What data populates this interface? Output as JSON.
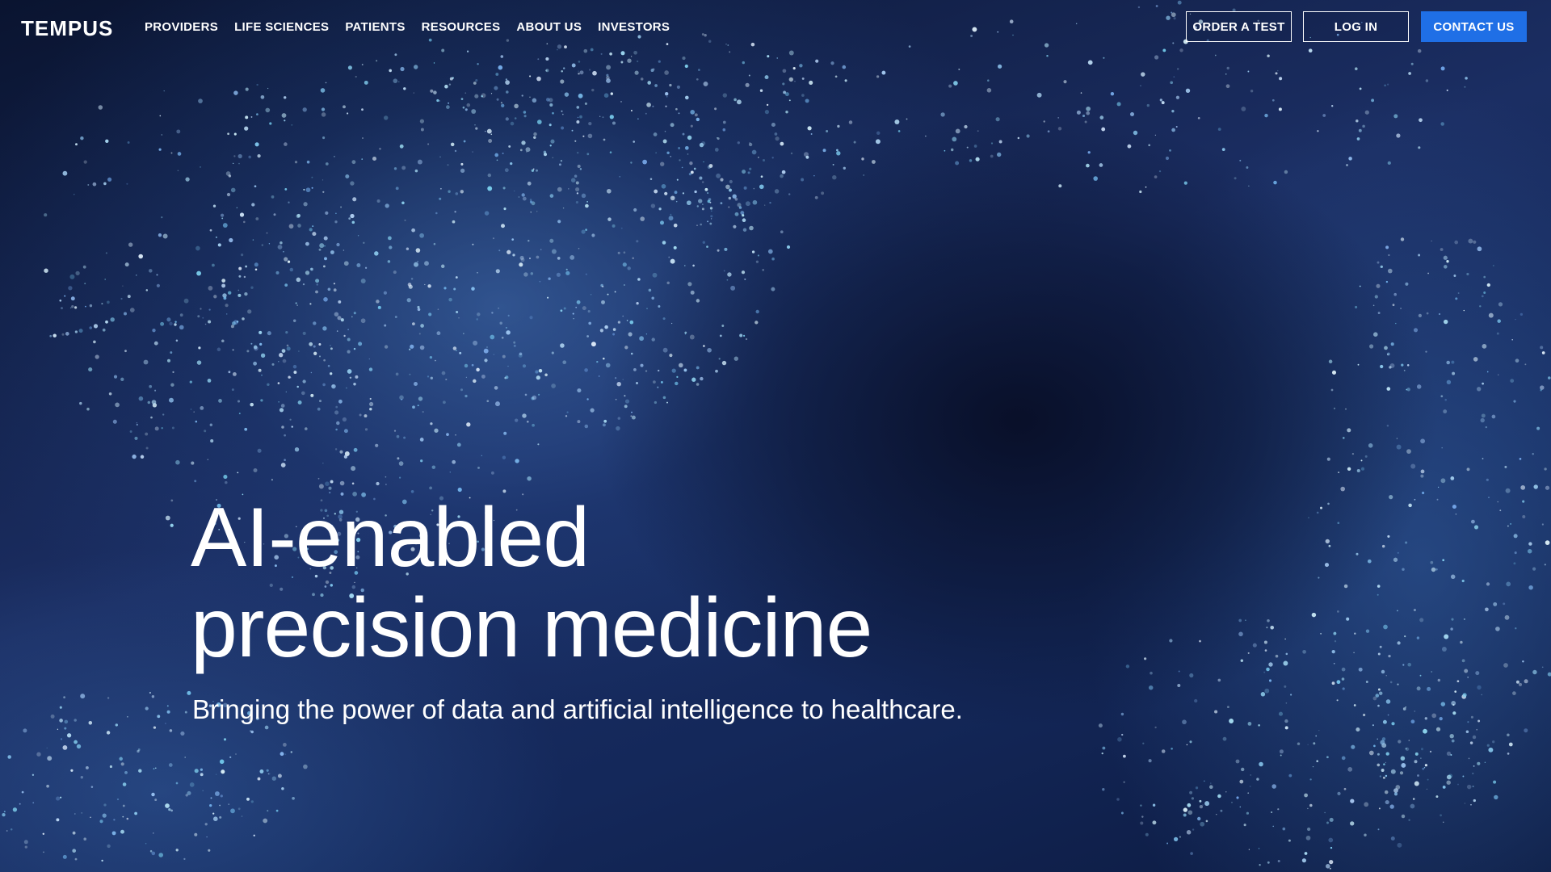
{
  "header": {
    "logo": "TEMPUS",
    "nav": [
      {
        "label": "PROVIDERS"
      },
      {
        "label": "LIFE SCIENCES"
      },
      {
        "label": "PATIENTS"
      },
      {
        "label": "RESOURCES"
      },
      {
        "label": "ABOUT US"
      },
      {
        "label": "INVESTORS"
      }
    ],
    "buttons": {
      "order_test": "ORDER A TEST",
      "log_in": "LOG IN",
      "contact_us": "CONTACT US"
    }
  },
  "hero": {
    "title_line1": "AI-enabled",
    "title_line2": "precision medicine",
    "subtitle": "Bringing the power of data and artificial intelligence to healthcare."
  },
  "colors": {
    "accent": "#1f6fe6",
    "background": "#14285a",
    "text": "#ffffff"
  }
}
